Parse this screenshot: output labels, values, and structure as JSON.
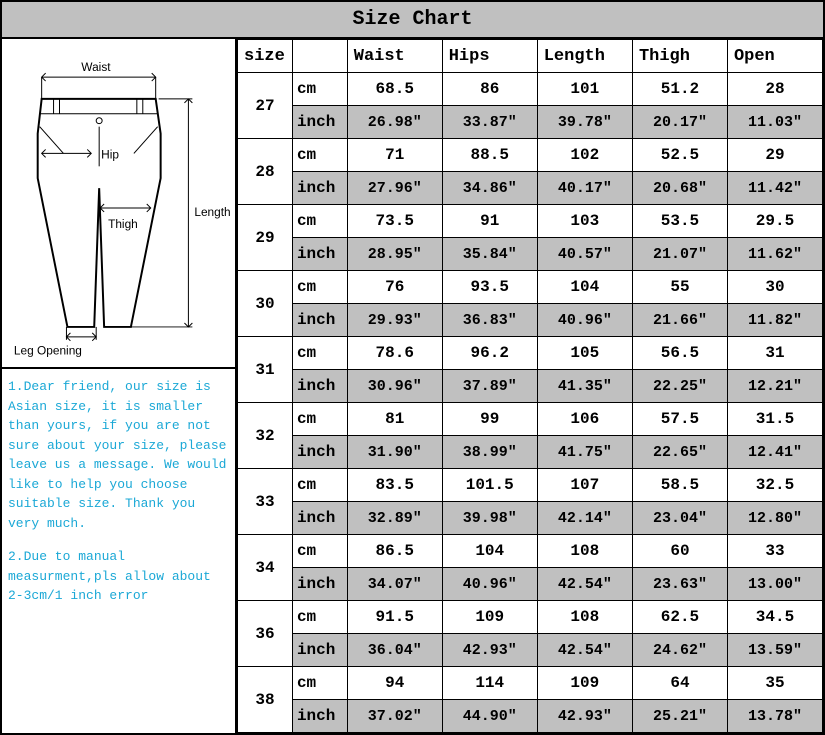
{
  "title": "Size Chart",
  "headers": {
    "size": "size",
    "unit": "",
    "waist": "Waist",
    "hips": "Hips",
    "length": "Length",
    "thigh": "Thigh",
    "open": "Open"
  },
  "units": {
    "cm": "cm",
    "inch": "inch"
  },
  "diagram_labels": {
    "waist": "Waist",
    "hip": "Hip",
    "thigh": "Thigh",
    "length": "Length",
    "leg_opening": "Leg Opening"
  },
  "notes": {
    "p1": "1.Dear friend, our size is Asian size, it is smaller than yours, if you are not sure about your size, please leave us a message. We would like to help you choose suitable size. Thank you very much.",
    "p2": "2.Due to manual measurment,pls allow about 2-3cm/1 inch error"
  },
  "chart_data": {
    "type": "table",
    "columns": [
      "size",
      "unit",
      "Waist",
      "Hips",
      "Length",
      "Thigh",
      "Open"
    ],
    "rows": [
      {
        "size": "27",
        "cm": [
          "68.5",
          "86",
          "101",
          "51.2",
          "28"
        ],
        "inch": [
          "26.98″",
          "33.87″",
          "39.78″",
          "20.17″",
          "11.03″"
        ]
      },
      {
        "size": "28",
        "cm": [
          "71",
          "88.5",
          "102",
          "52.5",
          "29"
        ],
        "inch": [
          "27.96″",
          "34.86″",
          "40.17″",
          "20.68″",
          "11.42″"
        ]
      },
      {
        "size": "29",
        "cm": [
          "73.5",
          "91",
          "103",
          "53.5",
          "29.5"
        ],
        "inch": [
          "28.95″",
          "35.84″",
          "40.57″",
          "21.07″",
          "11.62″"
        ]
      },
      {
        "size": "30",
        "cm": [
          "76",
          "93.5",
          "104",
          "55",
          "30"
        ],
        "inch": [
          "29.93″",
          "36.83″",
          "40.96″",
          "21.66″",
          "11.82″"
        ]
      },
      {
        "size": "31",
        "cm": [
          "78.6",
          "96.2",
          "105",
          "56.5",
          "31"
        ],
        "inch": [
          "30.96″",
          "37.89″",
          "41.35″",
          "22.25″",
          "12.21″"
        ]
      },
      {
        "size": "32",
        "cm": [
          "81",
          "99",
          "106",
          "57.5",
          "31.5"
        ],
        "inch": [
          "31.90″",
          "38.99″",
          "41.75″",
          "22.65″",
          "12.41″"
        ]
      },
      {
        "size": "33",
        "cm": [
          "83.5",
          "101.5",
          "107",
          "58.5",
          "32.5"
        ],
        "inch": [
          "32.89″",
          "39.98″",
          "42.14″",
          "23.04″",
          "12.80″"
        ]
      },
      {
        "size": "34",
        "cm": [
          "86.5",
          "104",
          "108",
          "60",
          "33"
        ],
        "inch": [
          "34.07″",
          "40.96″",
          "42.54″",
          "23.63″",
          "13.00″"
        ]
      },
      {
        "size": "36",
        "cm": [
          "91.5",
          "109",
          "108",
          "62.5",
          "34.5"
        ],
        "inch": [
          "36.04″",
          "42.93″",
          "42.54″",
          "24.62″",
          "13.59″"
        ]
      },
      {
        "size": "38",
        "cm": [
          "94",
          "114",
          "109",
          "64",
          "35"
        ],
        "inch": [
          "37.02″",
          "44.90″",
          "42.93″",
          "25.21″",
          "13.78″"
        ]
      }
    ]
  }
}
